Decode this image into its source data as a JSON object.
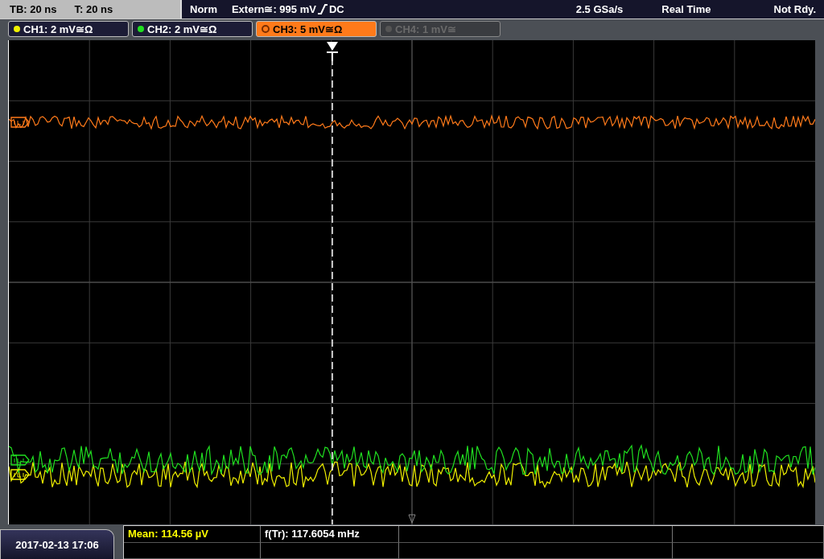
{
  "status_bar": {
    "timebase": "TB: 20 ns",
    "trigger_time": "T: 20 ns",
    "trigger_mode": "Norm",
    "trigger_source": "Extern≅: 995 mV",
    "trigger_coupling": "DC",
    "sample_rate": "2.5 GSa/s",
    "acquisition_mode": "Real Time",
    "state": "Not Rdy."
  },
  "channels": [
    {
      "label": "CH1: 2 mV≅Ω",
      "color": "#f0f000",
      "selected": false,
      "enabled": true
    },
    {
      "label": "CH2: 2 mV≅Ω",
      "color": "#20e020",
      "selected": false,
      "enabled": true
    },
    {
      "label": "CH3: 5 mV≅Ω",
      "color": "#ff7a1a",
      "selected": true,
      "enabled": true
    },
    {
      "label": "CH4: 1 mV≅",
      "color": "#555555",
      "selected": false,
      "enabled": false
    }
  ],
  "date_time": "2017-02-13 17:06",
  "measurements": [
    {
      "text": "Mean: 114.56 µV",
      "color": "#ffff00"
    },
    {
      "text": "f(Tr): 117.6054 mHz",
      "color": "#ffffff"
    }
  ]
}
